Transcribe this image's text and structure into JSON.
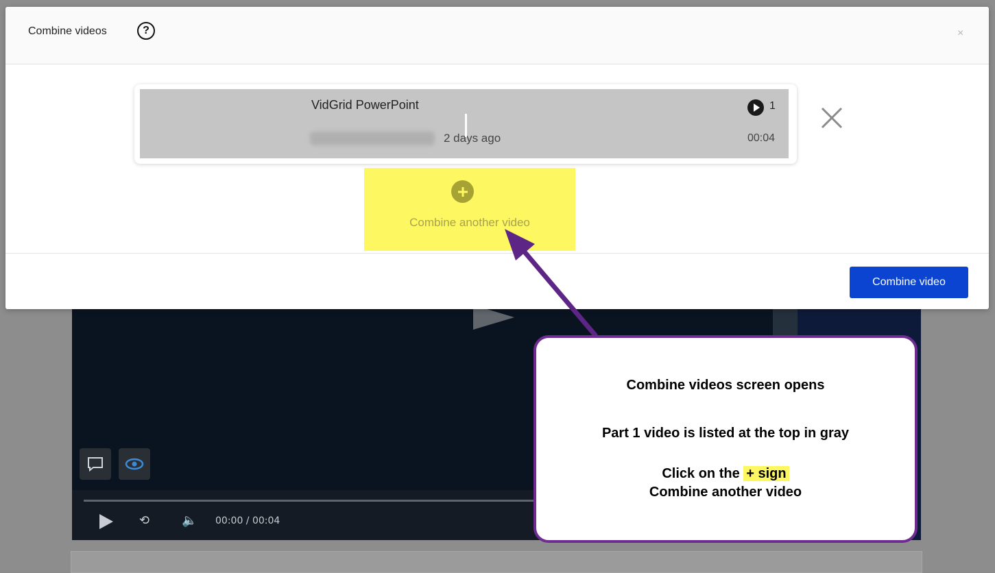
{
  "modal": {
    "title": "Combine videos",
    "close_label": "×",
    "video": {
      "title": "VidGrid PowerPoint",
      "date": "2 days ago",
      "play_count": "1",
      "duration": "00:04"
    },
    "add_label": "Combine another video",
    "combine_button": "Combine video"
  },
  "player": {
    "time": "00:00 / 00:04"
  },
  "callout": {
    "line1": "Combine videos screen opens",
    "line2": "Part 1 video is listed at the top in gray",
    "line3_prefix": "Click on the",
    "line3_highlight": "+ sign",
    "line4": "Combine another video"
  },
  "colors": {
    "accent": "#0c44d2",
    "highlight": "#fdf762",
    "callout_border": "#6e2c91"
  }
}
